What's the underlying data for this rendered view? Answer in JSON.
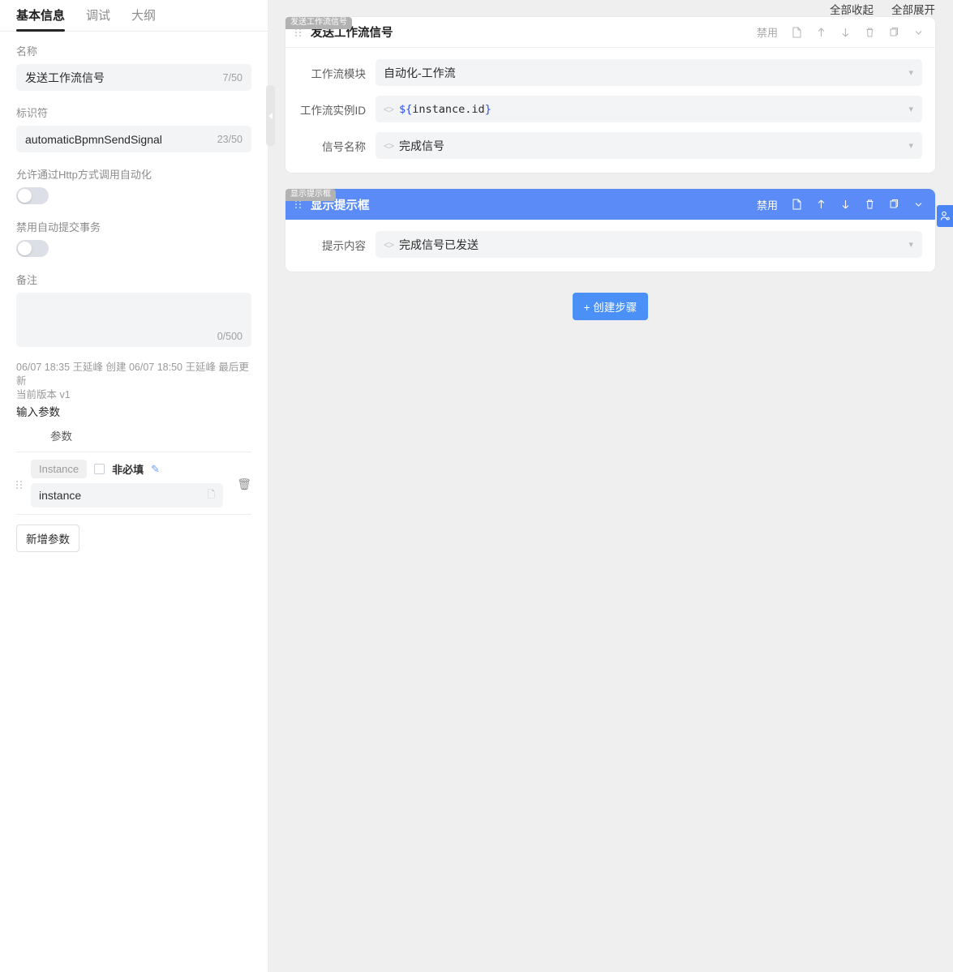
{
  "sidebar": {
    "tabs": [
      {
        "label": "基本信息",
        "active": true
      },
      {
        "label": "调试",
        "active": false
      },
      {
        "label": "大纲",
        "active": false
      }
    ],
    "name_field": {
      "label": "名称",
      "value": "发送工作流信号",
      "counter": "7/50"
    },
    "identifier_field": {
      "label": "标识符",
      "value": "automaticBpmnSendSignal",
      "counter": "23/50"
    },
    "toggle_http": {
      "label": "允许通过Http方式调用自动化",
      "state": "off"
    },
    "toggle_autocommit": {
      "label": "禁用自动提交事务",
      "state": "off"
    },
    "remark_field": {
      "label": "备注",
      "value": "",
      "counter": "0/500"
    },
    "meta": {
      "audit": "06/07 18:35 王延峰 创建 06/07 18:50 王延峰 最后更新",
      "version": "当前版本 v1",
      "input_params_title": "输入参数"
    },
    "params": {
      "column_header": "参数",
      "rows": [
        {
          "chip": "Instance",
          "optional_label": "非必填",
          "optional_checked": false,
          "edit_icon": "pencil-icon",
          "value": "instance",
          "delete_icon": "trash-icon"
        }
      ],
      "add_button": "新增参数"
    },
    "collapse_handle": "collapse-sidebar-handle"
  },
  "main": {
    "top_actions": [
      {
        "label": "全部收起",
        "name": "collapse-all"
      },
      {
        "label": "全部展开",
        "name": "expand-all"
      }
    ],
    "steps": [
      {
        "badge": "发送工作流信号",
        "title": "发送工作流信号",
        "selected": false,
        "toolbar": {
          "disable_label": "禁用",
          "icons": [
            "note-icon",
            "move-up-icon",
            "move-down-icon",
            "trash-icon",
            "copy-icon",
            "chevron-down-icon"
          ]
        },
        "fields": [
          {
            "label": "工作流模块",
            "value": "自动化-工作流",
            "has_code_mark": false,
            "mono": false
          },
          {
            "label": "工作流实例ID",
            "value": "${instance.id}",
            "has_code_mark": true,
            "mono": true
          },
          {
            "label": "信号名称",
            "value": "完成信号",
            "has_code_mark": true,
            "mono": false
          }
        ]
      },
      {
        "badge": "显示提示框",
        "title": "显示提示框",
        "selected": true,
        "toolbar": {
          "disable_label": "禁用",
          "icons": [
            "note-icon",
            "move-up-icon",
            "move-down-icon",
            "trash-icon",
            "copy-icon",
            "chevron-down-icon"
          ]
        },
        "fields": [
          {
            "label": "提示内容",
            "value": "完成信号已发送",
            "has_code_mark": true,
            "mono": false
          }
        ]
      }
    ],
    "create_step_button": "+ 创建步骤",
    "user_tab_icon": "user-icon"
  },
  "colors": {
    "accent_blue": "#4a90f7",
    "selected_header": "#5a8bf6",
    "variable_blue": "#2a50f0",
    "page_background": "#efefef",
    "field_background": "#f3f4f6"
  }
}
